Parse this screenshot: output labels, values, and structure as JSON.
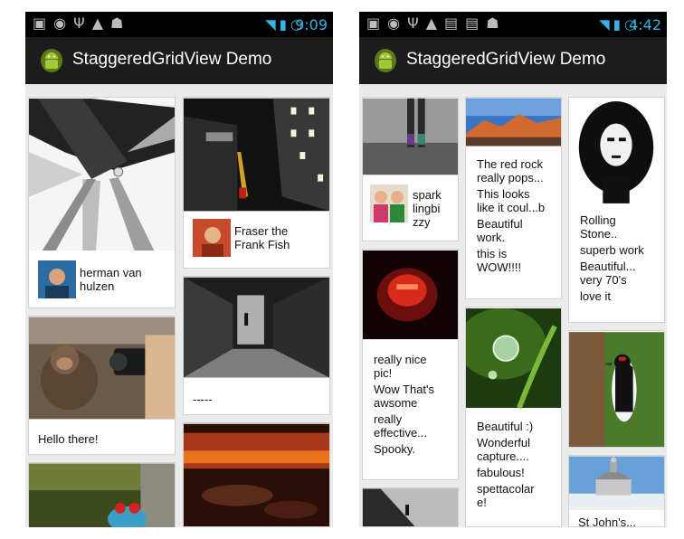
{
  "left": {
    "status": {
      "time": "9:09"
    },
    "title": "StaggeredGridView Demo",
    "cards": {
      "herman": "herman van\nhulzen",
      "fraser": "Fraser the\nFrank Fish",
      "dashes": "-----",
      "hello": "Hello there!"
    }
  },
  "right": {
    "status": {
      "time": "4:42"
    },
    "title": "StaggeredGridView Demo",
    "cards": {
      "spark": "spark\nlingbi\nzzy",
      "redrock": [
        "The red rock\nreally pops...",
        "This looks\nlike it coul...b",
        "Beautiful\nwork.",
        "this is\nWOW!!!!"
      ],
      "rolling": [
        "Rolling\nStone..",
        "superb work",
        "Beautiful...\nvery 70's",
        "love it"
      ],
      "nicepic": [
        "really nice\npic!",
        "Wow That's\nawsome",
        "really\neffective...",
        "Spooky."
      ],
      "beautiful": [
        "Beautiful :)",
        "Wonderful\ncapture....",
        "fabulous!",
        "spettacolar\ne!"
      ],
      "stjohns": "St John's..."
    }
  },
  "colors": {
    "accent": "#33b5e5",
    "actionbar": "#1c1c1c",
    "statusbar": "#000000",
    "android_green": "#a4c639"
  }
}
